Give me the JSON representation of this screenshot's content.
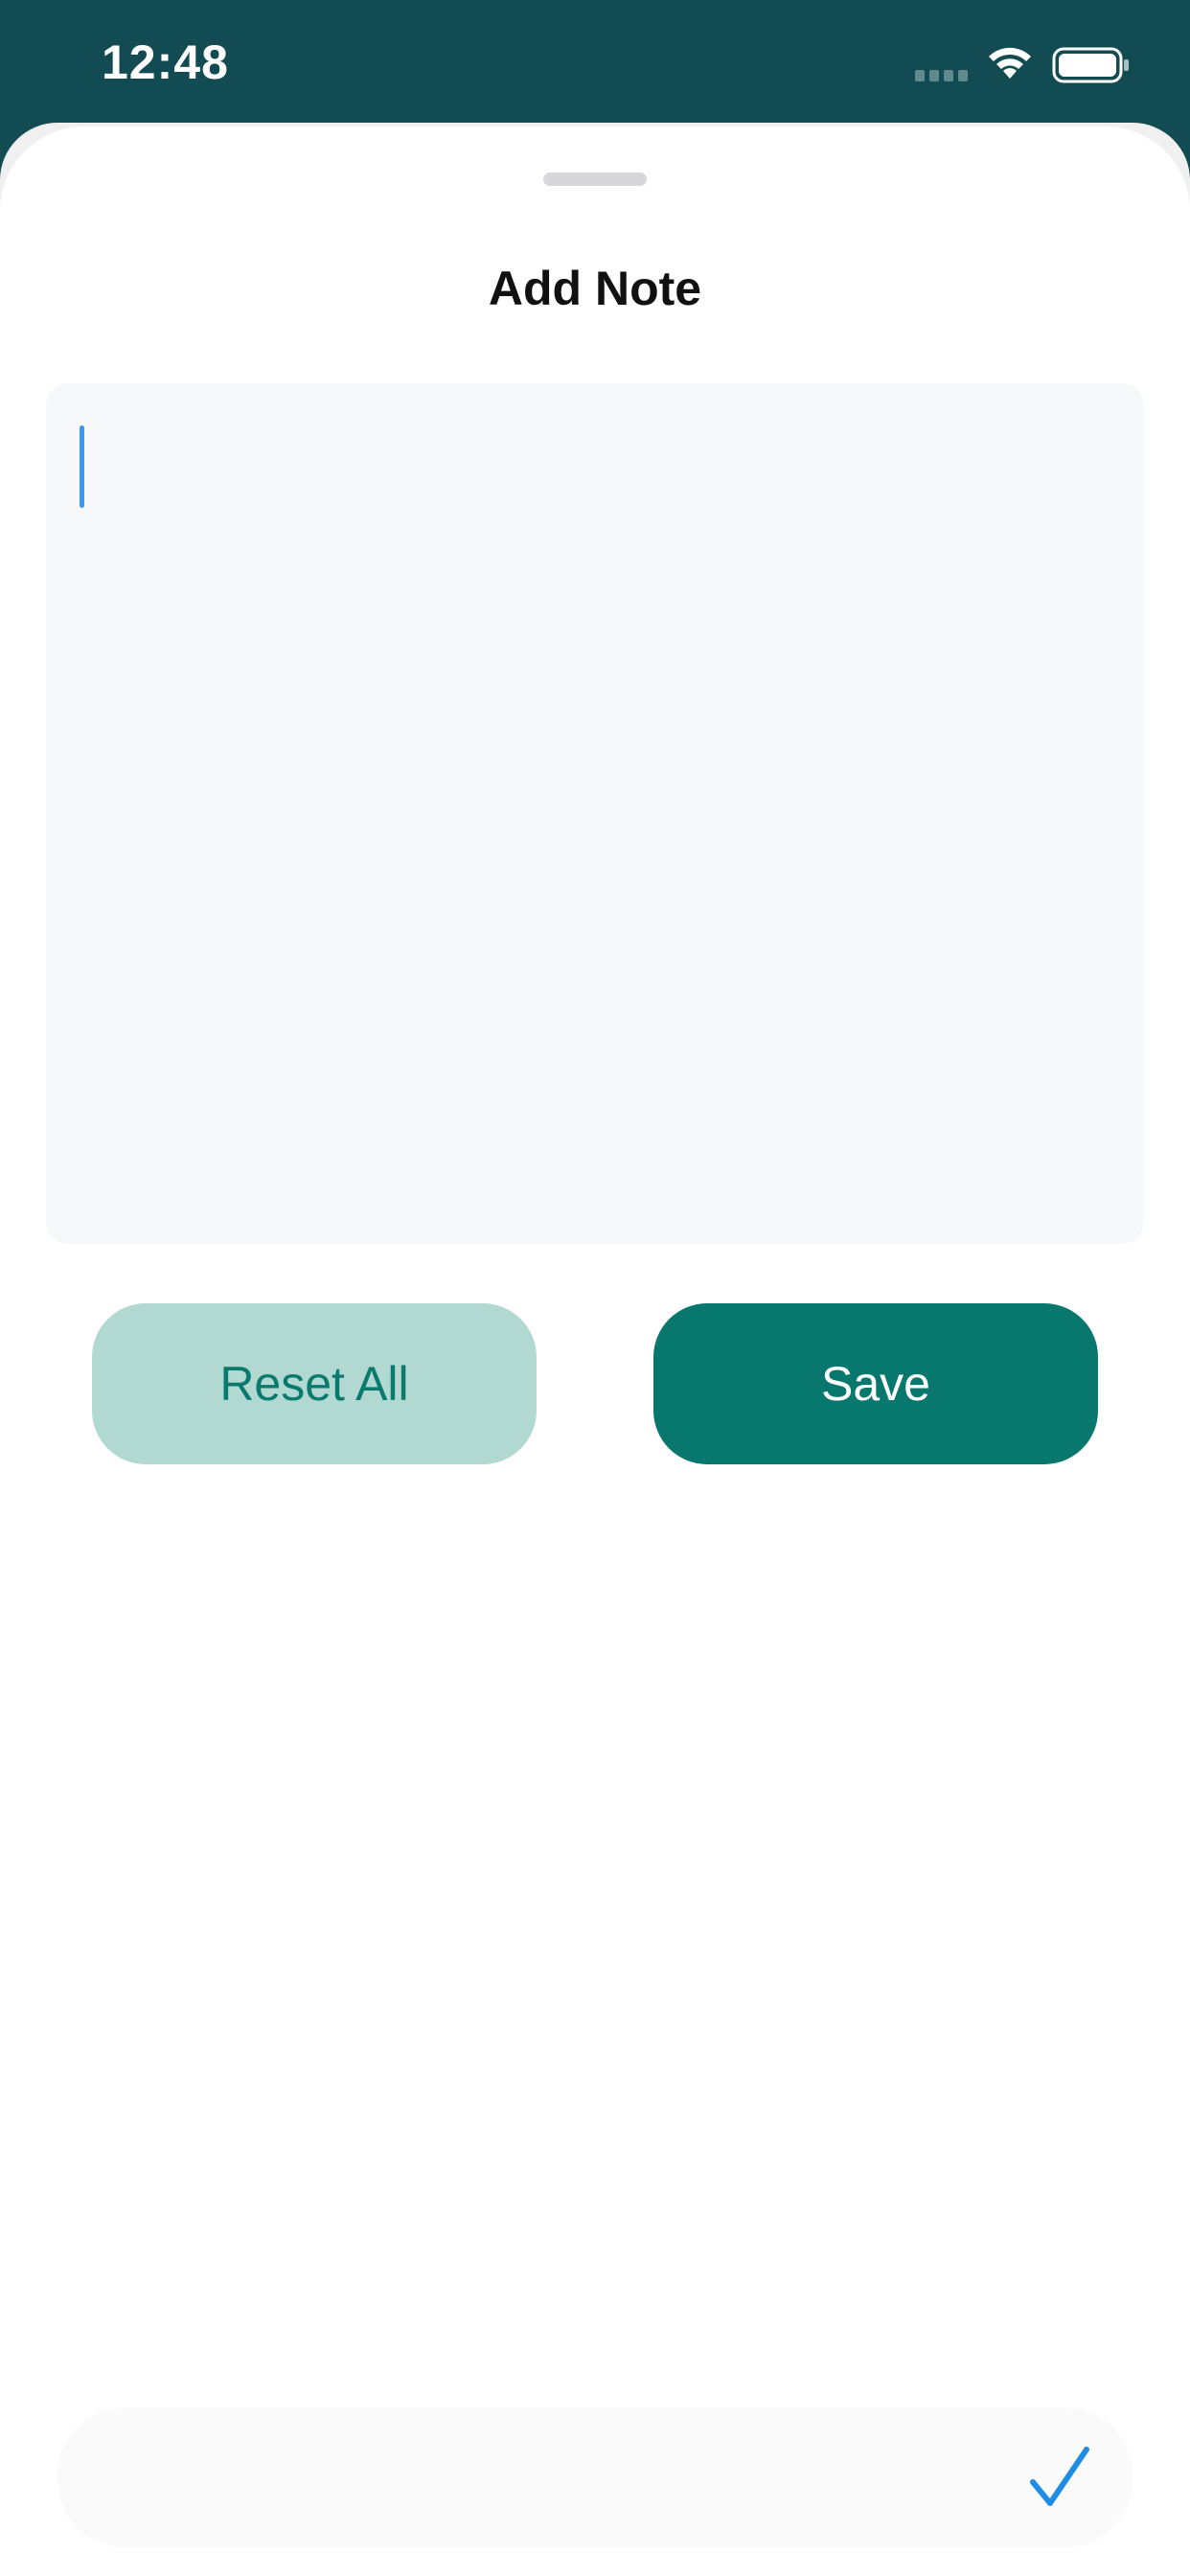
{
  "status_bar": {
    "time": "12:48",
    "icons": [
      "cellular-signal-icon",
      "wifi-icon",
      "battery-icon"
    ]
  },
  "sheet": {
    "title": "Add Note",
    "note_input": {
      "value": "",
      "placeholder": ""
    },
    "buttons": {
      "reset_label": "Reset All",
      "save_label": "Save"
    }
  },
  "keyboard_bar": {
    "icon": "checkmark-icon"
  },
  "colors": {
    "header_background": "#124b52",
    "accent": "#08786e",
    "reset_background": "#b2d8d2",
    "reset_text": "#0b7a6e",
    "caret": "#3a9af0",
    "checkmark": "#1f8de6"
  }
}
